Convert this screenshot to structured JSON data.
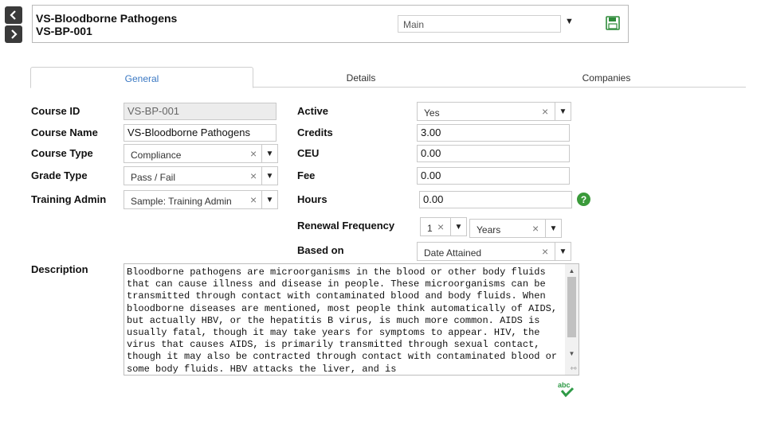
{
  "nav": {
    "prev_icon": "chevron-left-icon",
    "next_icon": "chevron-right-icon"
  },
  "header": {
    "title": "VS-Bloodborne Pathogens",
    "code": "VS-BP-001",
    "view_value": "Main",
    "save_icon": "floppy-disk-icon"
  },
  "tabs": [
    {
      "label": "General",
      "active": true
    },
    {
      "label": "Details",
      "active": false
    },
    {
      "label": "Companies",
      "active": false
    }
  ],
  "form": {
    "course_id": {
      "label": "Course ID",
      "value": "VS-BP-001"
    },
    "course_name": {
      "label": "Course Name",
      "value": "VS-Bloodborne Pathogens"
    },
    "course_type": {
      "label": "Course Type",
      "value": "Compliance"
    },
    "grade_type": {
      "label": "Grade Type",
      "value": "Pass / Fail"
    },
    "training_admin": {
      "label": "Training Admin",
      "value": "Sample: Training Admin"
    },
    "active": {
      "label": "Active",
      "value": "Yes"
    },
    "credits": {
      "label": "Credits",
      "value": "3.00"
    },
    "ceu": {
      "label": "CEU",
      "value": "0.00"
    },
    "fee": {
      "label": "Fee",
      "value": "0.00"
    },
    "hours": {
      "label": "Hours",
      "value": "0.00"
    },
    "renewal_frequency": {
      "label": "Renewal Frequency",
      "number": "1",
      "unit": "Years"
    },
    "based_on": {
      "label": "Based on",
      "value": "Date Attained"
    },
    "description": {
      "label": "Description",
      "value": "Bloodborne pathogens are microorganisms in the blood or other body fluids that can cause illness and disease in people. These microorganisms can be transmitted through contact with contaminated blood and body fluids. When bloodborne diseases are mentioned, most people think automatically of AIDS, but actually HBV, or the hepatitis B virus, is much more common. AIDS is usually fatal, though it may take years for symptoms to appear. HIV, the virus that causes AIDS, is primarily transmitted through sexual contact, though it may also be contracted through contact with contaminated blood or some body fluids. HBV attacks the liver, and is"
    },
    "spellcheck_label": "abc"
  },
  "colors": {
    "accent": "#3a78c3",
    "help": "#3a9a3a",
    "spell": "#2e9a46"
  }
}
